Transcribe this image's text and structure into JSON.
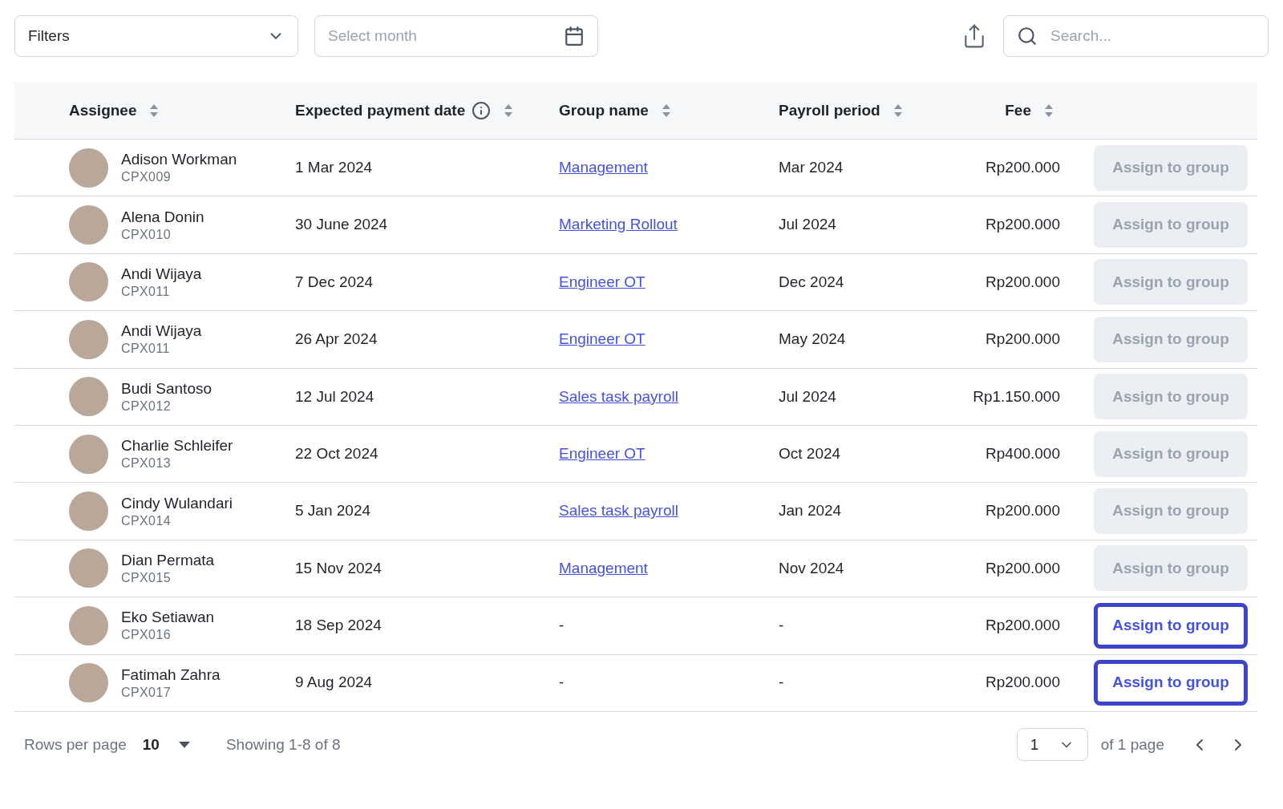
{
  "toolbar": {
    "filters": {
      "label": "Filters"
    },
    "month": {
      "placeholder": "Select month"
    },
    "search": {
      "placeholder": "Search..."
    }
  },
  "table": {
    "columns": [
      {
        "label": "Assignee",
        "kind": "plain"
      },
      {
        "label": "Expected payment date",
        "kind": "info"
      },
      {
        "label": "Group name",
        "kind": "plain"
      },
      {
        "label": "Payroll period",
        "kind": "plain"
      },
      {
        "label": "Fee",
        "kind": "plain"
      }
    ],
    "rows": [
      {
        "name": "Adison Workman",
        "code": "CPX009",
        "date": "1 Mar 2024",
        "group": "Management",
        "period": "Mar 2024",
        "fee": "Rp200.000",
        "action": "Assign to group",
        "disabled": true
      },
      {
        "name": "Alena Donin",
        "code": "CPX010",
        "date": "30 June 2024",
        "group": "Marketing Rollout",
        "period": "Jul 2024",
        "fee": "Rp200.000",
        "action": "Assign to group",
        "disabled": true
      },
      {
        "name": "Andi Wijaya",
        "code": "CPX011",
        "date": "7 Dec 2024",
        "group": "Engineer OT",
        "period": "Dec 2024",
        "fee": "Rp200.000",
        "action": "Assign to group",
        "disabled": true
      },
      {
        "name": "Andi Wijaya",
        "code": "CPX011",
        "date": "26 Apr 2024",
        "group": "Engineer OT",
        "period": "May 2024",
        "fee": "Rp200.000",
        "action": "Assign to group",
        "disabled": true
      },
      {
        "name": "Budi Santoso",
        "code": "CPX012",
        "date": "12 Jul 2024",
        "group": "Sales task payroll",
        "period": "Jul 2024",
        "fee": "Rp1.150.000",
        "action": "Assign to group",
        "disabled": true
      },
      {
        "name": "Charlie Schleifer",
        "code": "CPX013",
        "date": "22 Oct 2024",
        "group": "Engineer OT",
        "period": "Oct 2024",
        "fee": "Rp400.000",
        "action": "Assign to group",
        "disabled": true
      },
      {
        "name": "Cindy Wulandari",
        "code": "CPX014",
        "date": "5 Jan 2024",
        "group": "Sales task payroll",
        "period": "Jan 2024",
        "fee": "Rp200.000",
        "action": "Assign to group",
        "disabled": true
      },
      {
        "name": "Dian Permata",
        "code": "CPX015",
        "date": "15 Nov 2024",
        "group": "Management",
        "period": "Nov 2024",
        "fee": "Rp200.000",
        "action": "Assign to group",
        "disabled": true
      },
      {
        "name": "Eko Setiawan",
        "code": "CPX016",
        "date": "18 Sep 2024",
        "group": "-",
        "period": "-",
        "fee": "Rp200.000",
        "action": "Assign to group",
        "disabled": false
      },
      {
        "name": "Fatimah Zahra",
        "code": "CPX017",
        "date": "9 Aug 2024",
        "group": "-",
        "period": "-",
        "fee": "Rp200.000",
        "action": "Assign to group",
        "disabled": false
      }
    ]
  },
  "pagination": {
    "rows_label": "Rows per page",
    "rows_value": "10",
    "showing": "Showing 1-8 of 8",
    "page": "1",
    "of_pages": "of 1 page"
  }
}
